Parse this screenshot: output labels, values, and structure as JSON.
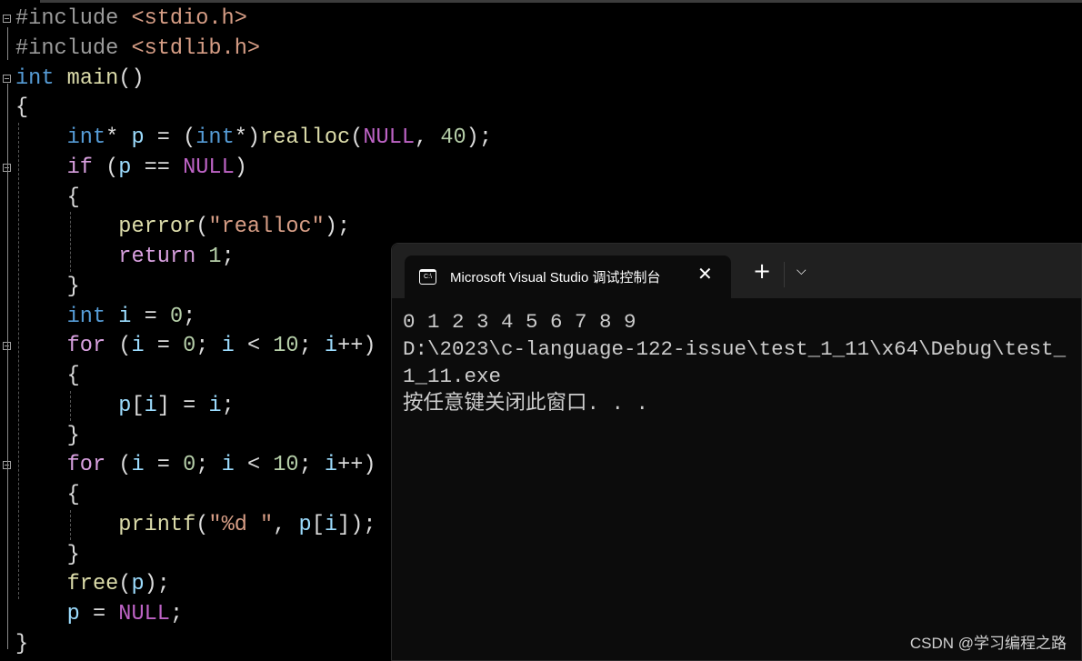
{
  "colors": {
    "keyword": "#569cd6",
    "control": "#d8a0df",
    "function": "#dcdcaa",
    "string": "#d69d85",
    "number": "#b5cea8",
    "variable": "#9cdcfe",
    "macro": "#bd63c5",
    "preprocessor": "#9b9b9b",
    "plain": "#dcdcdc",
    "include_path": "#d69d85",
    "terminal_bg": "#0c0c0c"
  },
  "code": [
    [
      [
        "preprocessor",
        "#include "
      ],
      [
        "include_path",
        "<stdio.h>"
      ]
    ],
    [
      [
        "preprocessor",
        "#include "
      ],
      [
        "include_path",
        "<stdlib.h>"
      ]
    ],
    [
      [
        "keyword",
        "int"
      ],
      [
        "plain",
        " "
      ],
      [
        "function",
        "main"
      ],
      [
        "plain",
        "()"
      ]
    ],
    [
      [
        "plain",
        "{"
      ]
    ],
    [
      [
        "plain",
        "    "
      ],
      [
        "keyword",
        "int"
      ],
      [
        "plain",
        "* "
      ],
      [
        "variable",
        "p"
      ],
      [
        "plain",
        " = ("
      ],
      [
        "keyword",
        "int"
      ],
      [
        "plain",
        "*)"
      ],
      [
        "function",
        "realloc"
      ],
      [
        "plain",
        "("
      ],
      [
        "macro",
        "NULL"
      ],
      [
        "plain",
        ", "
      ],
      [
        "number",
        "40"
      ],
      [
        "plain",
        ");"
      ]
    ],
    [
      [
        "plain",
        "    "
      ],
      [
        "control",
        "if"
      ],
      [
        "plain",
        " ("
      ],
      [
        "variable",
        "p"
      ],
      [
        "plain",
        " == "
      ],
      [
        "macro",
        "NULL"
      ],
      [
        "plain",
        ")"
      ]
    ],
    [
      [
        "plain",
        "    {"
      ]
    ],
    [
      [
        "plain",
        "        "
      ],
      [
        "function",
        "perror"
      ],
      [
        "plain",
        "("
      ],
      [
        "string",
        "\"realloc\""
      ],
      [
        "plain",
        ");"
      ]
    ],
    [
      [
        "plain",
        "        "
      ],
      [
        "control",
        "return"
      ],
      [
        "plain",
        " "
      ],
      [
        "number",
        "1"
      ],
      [
        "plain",
        ";"
      ]
    ],
    [
      [
        "plain",
        "    }"
      ]
    ],
    [
      [
        "plain",
        "    "
      ],
      [
        "keyword",
        "int"
      ],
      [
        "plain",
        " "
      ],
      [
        "variable",
        "i"
      ],
      [
        "plain",
        " = "
      ],
      [
        "number",
        "0"
      ],
      [
        "plain",
        ";"
      ]
    ],
    [
      [
        "plain",
        "    "
      ],
      [
        "control",
        "for"
      ],
      [
        "plain",
        " ("
      ],
      [
        "variable",
        "i"
      ],
      [
        "plain",
        " = "
      ],
      [
        "number",
        "0"
      ],
      [
        "plain",
        "; "
      ],
      [
        "variable",
        "i"
      ],
      [
        "plain",
        " < "
      ],
      [
        "number",
        "10"
      ],
      [
        "plain",
        "; "
      ],
      [
        "variable",
        "i"
      ],
      [
        "plain",
        "++)"
      ]
    ],
    [
      [
        "plain",
        "    {"
      ]
    ],
    [
      [
        "plain",
        "        "
      ],
      [
        "variable",
        "p"
      ],
      [
        "plain",
        "["
      ],
      [
        "variable",
        "i"
      ],
      [
        "plain",
        "] = "
      ],
      [
        "variable",
        "i"
      ],
      [
        "plain",
        ";"
      ]
    ],
    [
      [
        "plain",
        "    }"
      ]
    ],
    [
      [
        "plain",
        "    "
      ],
      [
        "control",
        "for"
      ],
      [
        "plain",
        " ("
      ],
      [
        "variable",
        "i"
      ],
      [
        "plain",
        " = "
      ],
      [
        "number",
        "0"
      ],
      [
        "plain",
        "; "
      ],
      [
        "variable",
        "i"
      ],
      [
        "plain",
        " < "
      ],
      [
        "number",
        "10"
      ],
      [
        "plain",
        "; "
      ],
      [
        "variable",
        "i"
      ],
      [
        "plain",
        "++)"
      ]
    ],
    [
      [
        "plain",
        "    {"
      ]
    ],
    [
      [
        "plain",
        "        "
      ],
      [
        "function",
        "printf"
      ],
      [
        "plain",
        "("
      ],
      [
        "string",
        "\"%d \""
      ],
      [
        "plain",
        ", "
      ],
      [
        "variable",
        "p"
      ],
      [
        "plain",
        "["
      ],
      [
        "variable",
        "i"
      ],
      [
        "plain",
        "]);"
      ]
    ],
    [
      [
        "plain",
        "    }"
      ]
    ],
    [
      [
        "plain",
        "    "
      ],
      [
        "function",
        "free"
      ],
      [
        "plain",
        "("
      ],
      [
        "variable",
        "p"
      ],
      [
        "plain",
        ");"
      ]
    ],
    [
      [
        "plain",
        "    "
      ],
      [
        "variable",
        "p"
      ],
      [
        "plain",
        " = "
      ],
      [
        "macro",
        "NULL"
      ],
      [
        "plain",
        ";"
      ]
    ],
    [
      [
        "plain",
        "}"
      ]
    ]
  ],
  "terminal": {
    "tab_icon_text": "C:\\",
    "tab_title": "Microsoft Visual Studio 调试控制台",
    "close_glyph": "✕",
    "new_tab_glyph": "+",
    "dropdown_glyph": "⌵",
    "output": [
      "0 1 2 3 4 5 6 7 8 9",
      "D:\\2023\\c-language-122-issue\\test_1_11\\x64\\Debug\\test_1_11.exe",
      "按任意键关闭此窗口. . ."
    ]
  },
  "watermark": "CSDN @学习编程之路"
}
